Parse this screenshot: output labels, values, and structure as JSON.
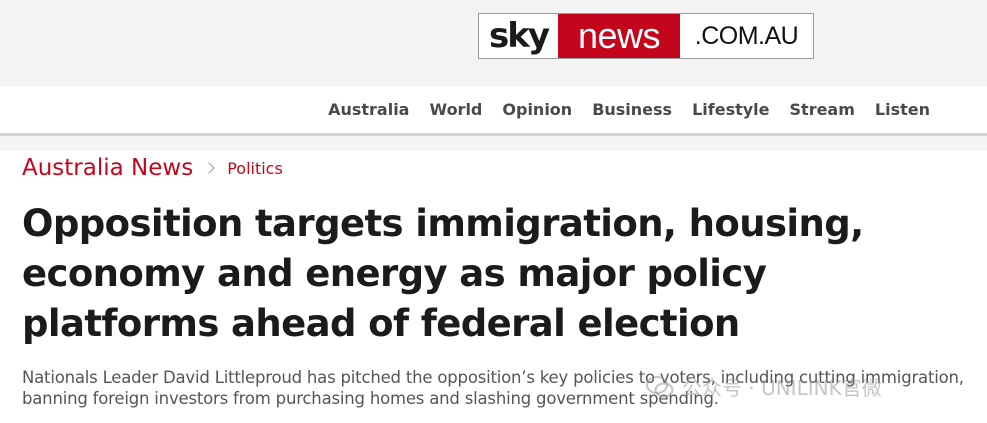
{
  "logo": {
    "sky": "sky",
    "news": "news",
    "domain": ".COM.AU"
  },
  "nav": {
    "items": [
      {
        "label": "Australia"
      },
      {
        "label": "World"
      },
      {
        "label": "Opinion"
      },
      {
        "label": "Business"
      },
      {
        "label": "Lifestyle"
      },
      {
        "label": "Stream"
      },
      {
        "label": "Listen"
      }
    ]
  },
  "breadcrumb": {
    "section": "Australia News",
    "subsection": "Politics"
  },
  "article": {
    "headline": "Opposition targets immigration, housing, economy and energy as major policy platforms ahead of federal election",
    "summary": "Nationals Leader David Littleproud has pitched the opposition’s key policies to voters, including cutting immigration, banning foreign investors from purchasing homes and slashing government spending."
  },
  "watermark": {
    "text": "公众号 · UNILINK官微"
  },
  "colors": {
    "brand_red": "#c4061c",
    "headline": "#1b1b1b",
    "nav_text": "#4a4a4a"
  }
}
